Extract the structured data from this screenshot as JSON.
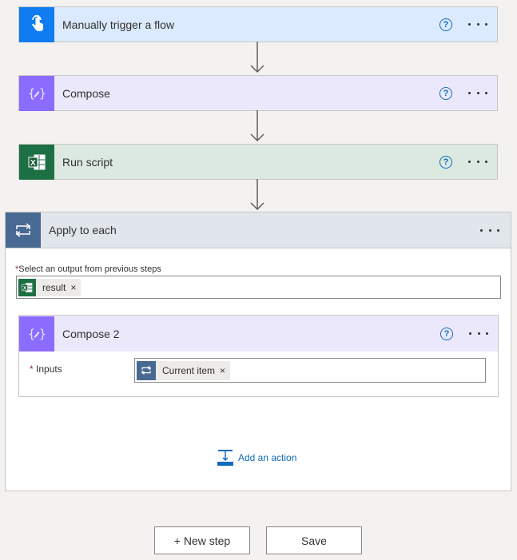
{
  "steps": [
    {
      "title": "Manually trigger a flow",
      "icon": "touch-icon",
      "bg": "#dbeafe",
      "icon_bg": "#0f7cf2"
    },
    {
      "title": "Compose",
      "icon": "compose-icon",
      "bg": "#ece8fb",
      "icon_bg": "#8c6cff"
    },
    {
      "title": "Run script",
      "icon": "excel-icon",
      "bg": "#dbe9e1",
      "icon_bg": "#1d7044"
    }
  ],
  "apply": {
    "title": "Apply to each",
    "field_required": "*",
    "field_label": "Select an output from previous steps",
    "token_label": "result",
    "token_close": "×"
  },
  "compose2": {
    "title": "Compose 2",
    "inputs_required": "*",
    "inputs_label": "Inputs",
    "token_label": "Current item",
    "token_close": "×"
  },
  "add_action_label": "Add an action",
  "buttons": {
    "new_step": "+ New step",
    "save": "Save"
  },
  "help_glyph": "?"
}
